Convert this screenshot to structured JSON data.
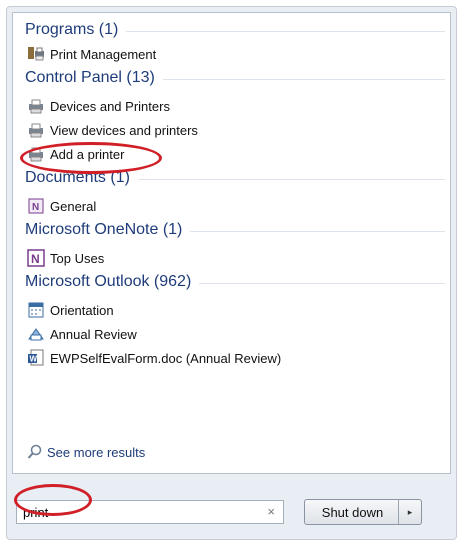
{
  "groups": [
    {
      "header": "Programs (1)",
      "items": [
        {
          "label": "Print Management",
          "icon": "print-management-icon"
        }
      ]
    },
    {
      "header": "Control Panel (13)",
      "items": [
        {
          "label": "Devices and Printers",
          "icon": "devices-printers-icon"
        },
        {
          "label": "View devices and printers",
          "icon": "devices-printers-icon"
        },
        {
          "label": "Add a printer",
          "icon": "printer-icon"
        }
      ]
    },
    {
      "header": "Documents (1)",
      "items": [
        {
          "label": "General",
          "icon": "onenote-section-icon"
        }
      ]
    },
    {
      "header": "Microsoft OneNote (1)",
      "items": [
        {
          "label": "Top Uses",
          "icon": "onenote-icon"
        }
      ]
    },
    {
      "header": "Microsoft Outlook (962)",
      "items": [
        {
          "label": "Orientation",
          "icon": "calendar-icon"
        },
        {
          "label": "Annual Review",
          "icon": "meeting-request-icon"
        },
        {
          "label": "EWPSelfEvalForm.doc (Annual Review)",
          "icon": "word-document-icon"
        }
      ]
    }
  ],
  "see_more": "See more results",
  "search": {
    "value": "print",
    "clear_glyph": "×"
  },
  "shutdown": {
    "label": "Shut down",
    "arrow": "▸"
  },
  "colors": {
    "accent": "#1e3c7a",
    "highlight_ring": "#d11f27"
  }
}
